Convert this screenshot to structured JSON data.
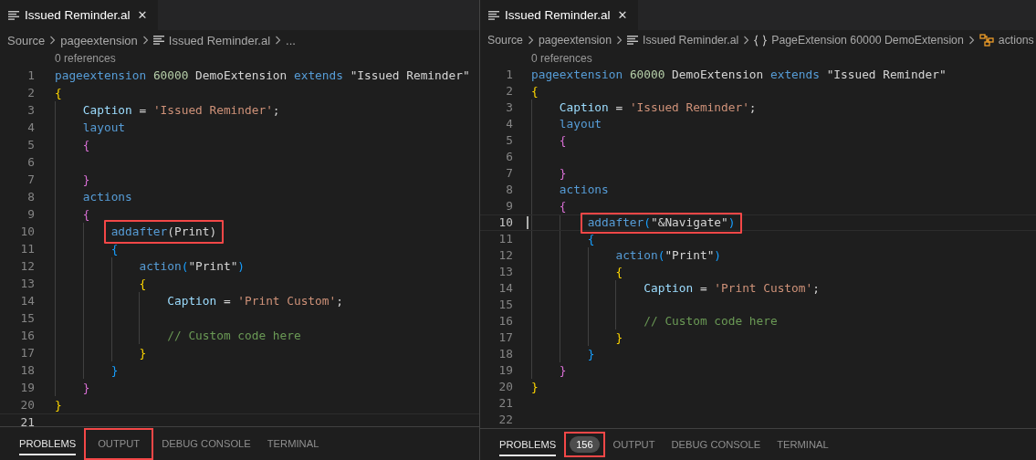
{
  "editors": [
    {
      "tab": {
        "title": "Issued Reminder.al",
        "close": "✕"
      },
      "breadcrumbs": [
        {
          "kind": "folder",
          "label": "Source"
        },
        {
          "kind": "folder",
          "label": "pageextension"
        },
        {
          "kind": "file",
          "label": "Issued Reminder.al"
        },
        {
          "kind": "more",
          "label": "..."
        }
      ],
      "codelens": "0 references",
      "lines": [
        {
          "number": "1",
          "tokens": [
            {
              "kind": "kw",
              "text": "pageextension"
            },
            {
              "kind": "num",
              "text": " 60000"
            },
            {
              "kind": "id",
              "text": " DemoExtension "
            },
            {
              "kind": "kw",
              "text": "extends"
            },
            {
              "kind": "id",
              "text": " \"Issued Reminder\""
            }
          ]
        },
        {
          "number": "2",
          "tokens": [
            {
              "kind": "br",
              "text": "{"
            }
          ]
        },
        {
          "number": "3",
          "tokens": [
            {
              "kind": "field",
              "text": "    Caption"
            },
            {
              "kind": "id",
              "text": " = "
            },
            {
              "kind": "str",
              "text": "'Issued Reminder'"
            },
            {
              "kind": "id",
              "text": ";"
            }
          ]
        },
        {
          "number": "4",
          "tokens": [
            {
              "kind": "kw",
              "text": "    layout"
            }
          ]
        },
        {
          "number": "5",
          "tokens": [
            {
              "kind": "br2",
              "text": "    {"
            }
          ]
        },
        {
          "number": "6"
        },
        {
          "number": "7",
          "tokens": [
            {
              "kind": "br2",
              "text": "    }"
            }
          ]
        },
        {
          "number": "8",
          "tokens": [
            {
              "kind": "kw",
              "text": "    actions"
            }
          ]
        },
        {
          "number": "9",
          "tokens": [
            {
              "kind": "br2",
              "text": "    {"
            }
          ]
        },
        {
          "number": "10",
          "highlighted": true,
          "tokens": [
            {
              "kind": "kw",
              "text": "        addafter"
            },
            {
              "kind": "id",
              "text": "(Print)"
            }
          ]
        },
        {
          "number": "11",
          "tokens": [
            {
              "kind": "br3",
              "text": "        {"
            }
          ]
        },
        {
          "number": "12",
          "tokens": [
            {
              "kind": "kw",
              "text": "            action"
            },
            {
              "kind": "br3",
              "text": "("
            },
            {
              "kind": "id",
              "text": "\"Print\""
            },
            {
              "kind": "br3",
              "text": ")"
            }
          ]
        },
        {
          "number": "13",
          "tokens": [
            {
              "kind": "br",
              "text": "            {"
            }
          ]
        },
        {
          "number": "14",
          "tokens": [
            {
              "kind": "field",
              "text": "                Caption"
            },
            {
              "kind": "id",
              "text": " = "
            },
            {
              "kind": "str",
              "text": "'Print Custom'"
            },
            {
              "kind": "id",
              "text": ";"
            }
          ]
        },
        {
          "number": "15"
        },
        {
          "number": "16",
          "tokens": [
            {
              "kind": "cm",
              "text": "                // Custom code here"
            }
          ]
        },
        {
          "number": "17",
          "tokens": [
            {
              "kind": "br",
              "text": "            }"
            }
          ]
        },
        {
          "number": "18",
          "tokens": [
            {
              "kind": "br3",
              "text": "        }"
            }
          ]
        },
        {
          "number": "19",
          "tokens": [
            {
              "kind": "br2",
              "text": "    }"
            }
          ]
        },
        {
          "number": "20",
          "tokens": [
            {
              "kind": "br",
              "text": "}"
            }
          ]
        },
        {
          "number": "21",
          "current": true
        }
      ],
      "panel_tabs": [
        {
          "label": "PROBLEMS",
          "selected": true,
          "highlighted": false
        },
        {
          "label": "OUTPUT",
          "selected": false,
          "highlighted": true
        },
        {
          "label": "DEBUG CONSOLE",
          "selected": false,
          "highlighted": false
        },
        {
          "label": "TERMINAL",
          "selected": false,
          "highlighted": false
        }
      ]
    },
    {
      "tab": {
        "title": "Issued Reminder.al",
        "close": "✕"
      },
      "breadcrumbs": [
        {
          "kind": "folder",
          "label": "Source"
        },
        {
          "kind": "folder",
          "label": "pageextension"
        },
        {
          "kind": "file",
          "label": "Issued Reminder.al"
        },
        {
          "kind": "symbol",
          "label": "PageExtension 60000 DemoExtension"
        },
        {
          "kind": "actions",
          "label": "actions"
        }
      ],
      "codelens": "0 references",
      "lines": [
        {
          "number": "1",
          "tokens": [
            {
              "kind": "kw",
              "text": "pageextension"
            },
            {
              "kind": "num",
              "text": " 60000"
            },
            {
              "kind": "id",
              "text": " DemoExtension "
            },
            {
              "kind": "kw",
              "text": "extends"
            },
            {
              "kind": "id",
              "text": " \"Issued Reminder\""
            }
          ]
        },
        {
          "number": "2",
          "tokens": [
            {
              "kind": "br",
              "text": "{"
            }
          ]
        },
        {
          "number": "3",
          "tokens": [
            {
              "kind": "field",
              "text": "    Caption"
            },
            {
              "kind": "id",
              "text": " = "
            },
            {
              "kind": "str",
              "text": "'Issued Reminder'"
            },
            {
              "kind": "id",
              "text": ";"
            }
          ]
        },
        {
          "number": "4",
          "tokens": [
            {
              "kind": "kw",
              "text": "    layout"
            }
          ]
        },
        {
          "number": "5",
          "tokens": [
            {
              "kind": "br2",
              "text": "    {"
            }
          ]
        },
        {
          "number": "6"
        },
        {
          "number": "7",
          "tokens": [
            {
              "kind": "br2",
              "text": "    }"
            }
          ]
        },
        {
          "number": "8",
          "tokens": [
            {
              "kind": "kw",
              "text": "    actions"
            }
          ]
        },
        {
          "number": "9",
          "tokens": [
            {
              "kind": "br2",
              "text": "    {"
            }
          ]
        },
        {
          "number": "10",
          "current": true,
          "highlighted": true,
          "tokens": [
            {
              "kind": "kw",
              "text": "        addafter"
            },
            {
              "kind": "br3",
              "text": "("
            },
            {
              "kind": "id",
              "text": "\"&Navigate\""
            },
            {
              "kind": "br3",
              "text": ")"
            }
          ]
        },
        {
          "number": "11",
          "tokens": [
            {
              "kind": "br3",
              "text": "        {"
            }
          ]
        },
        {
          "number": "12",
          "tokens": [
            {
              "kind": "kw",
              "text": "            action"
            },
            {
              "kind": "br3",
              "text": "("
            },
            {
              "kind": "id",
              "text": "\"Print\""
            },
            {
              "kind": "br3",
              "text": ")"
            }
          ]
        },
        {
          "number": "13",
          "tokens": [
            {
              "kind": "br",
              "text": "            {"
            }
          ]
        },
        {
          "number": "14",
          "tokens": [
            {
              "kind": "field",
              "text": "                Caption"
            },
            {
              "kind": "id",
              "text": " = "
            },
            {
              "kind": "str",
              "text": "'Print Custom'"
            },
            {
              "kind": "id",
              "text": ";"
            }
          ]
        },
        {
          "number": "15"
        },
        {
          "number": "16",
          "tokens": [
            {
              "kind": "cm",
              "text": "                // Custom code here"
            }
          ]
        },
        {
          "number": "17",
          "tokens": [
            {
              "kind": "br",
              "text": "            }"
            }
          ]
        },
        {
          "number": "18",
          "tokens": [
            {
              "kind": "br3",
              "text": "        }"
            }
          ]
        },
        {
          "number": "19",
          "tokens": [
            {
              "kind": "br2",
              "text": "    }"
            }
          ]
        },
        {
          "number": "20",
          "tokens": [
            {
              "kind": "br",
              "text": "}"
            }
          ]
        },
        {
          "number": "21"
        },
        {
          "number": "22"
        }
      ],
      "panel_tabs": [
        {
          "label": "PROBLEMS",
          "selected": true,
          "highlighted": false
        },
        {
          "label": "156",
          "kind": "badge",
          "highlighted": true
        },
        {
          "label": "OUTPUT",
          "selected": false,
          "highlighted": false
        },
        {
          "label": "DEBUG CONSOLE",
          "selected": false,
          "highlighted": false
        },
        {
          "label": "TERMINAL",
          "selected": false,
          "highlighted": false
        }
      ]
    }
  ]
}
